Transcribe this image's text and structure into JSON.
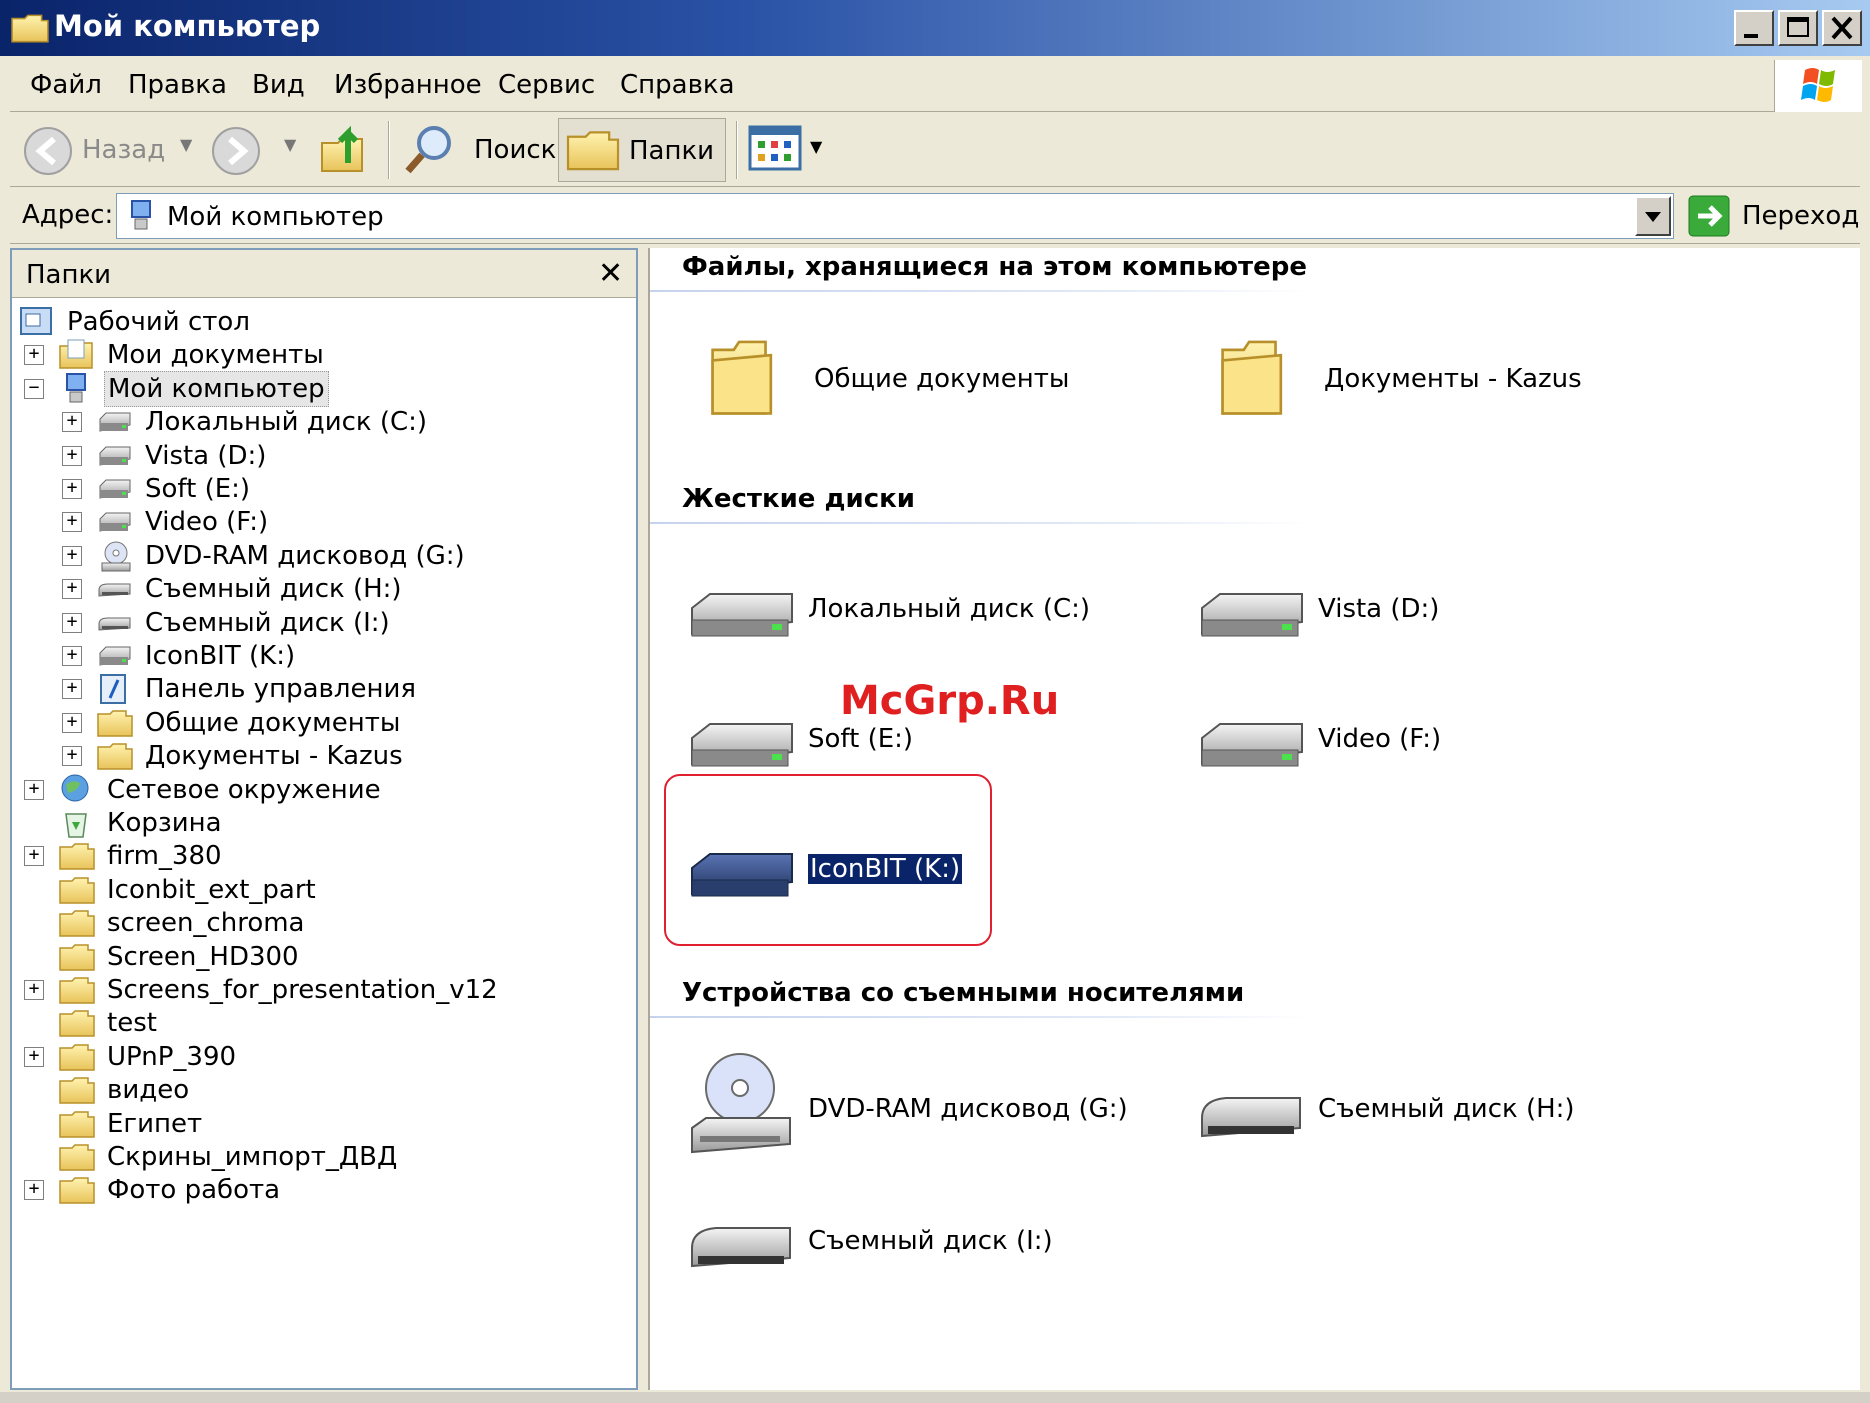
{
  "window": {
    "title": "Мой компьютер"
  },
  "menu": {
    "items": [
      "Файл",
      "Правка",
      "Вид",
      "Избранное",
      "Сервис",
      "Справка"
    ]
  },
  "toolbar": {
    "back_label": "Назад",
    "search_label": "Поиск",
    "folders_label": "Папки"
  },
  "address": {
    "label": "Адрес:",
    "value": "Мой компьютер",
    "go_label": "Переход"
  },
  "folders_pane": {
    "title": "Папки",
    "close_glyph": "✕",
    "tree": [
      {
        "label": "Рабочий стол",
        "icon": "desktop-icon",
        "level": 0,
        "expander": ""
      },
      {
        "label": "Мои документы",
        "icon": "my-documents-icon",
        "level": 1,
        "expander": "+"
      },
      {
        "label": "Мой компьютер",
        "icon": "my-computer-icon",
        "level": 1,
        "expander": "−",
        "selected": true
      },
      {
        "label": "Локальный диск (C:)",
        "icon": "hard-drive-icon",
        "level": 2,
        "expander": "+"
      },
      {
        "label": "Vista (D:)",
        "icon": "hard-drive-icon",
        "level": 2,
        "expander": "+"
      },
      {
        "label": "Soft (E:)",
        "icon": "hard-drive-icon",
        "level": 2,
        "expander": "+"
      },
      {
        "label": "Video (F:)",
        "icon": "hard-drive-icon",
        "level": 2,
        "expander": "+"
      },
      {
        "label": "DVD-RAM дисковод (G:)",
        "icon": "dvd-drive-icon",
        "level": 2,
        "expander": "+"
      },
      {
        "label": "Съемный диск (H:)",
        "icon": "removable-drive-icon",
        "level": 2,
        "expander": "+"
      },
      {
        "label": "Съемный диск (I:)",
        "icon": "removable-drive-icon",
        "level": 2,
        "expander": "+"
      },
      {
        "label": "IconBIT (K:)",
        "icon": "hard-drive-icon",
        "level": 2,
        "expander": "+"
      },
      {
        "label": "Панель управления",
        "icon": "control-panel-icon",
        "level": 2,
        "expander": "+"
      },
      {
        "label": "Общие документы",
        "icon": "folder-icon",
        "level": 2,
        "expander": "+"
      },
      {
        "label": "Документы - Kazus",
        "icon": "folder-icon",
        "level": 2,
        "expander": "+"
      },
      {
        "label": "Сетевое окружение",
        "icon": "network-icon",
        "level": 1,
        "expander": "+"
      },
      {
        "label": "Корзина",
        "icon": "recycle-bin-icon",
        "level": 1,
        "expander": ""
      },
      {
        "label": "firm_380",
        "icon": "folder-icon",
        "level": 1,
        "expander": "+"
      },
      {
        "label": "Iconbit_ext_part",
        "icon": "folder-icon",
        "level": 1,
        "expander": ""
      },
      {
        "label": "screen_chroma",
        "icon": "folder-icon",
        "level": 1,
        "expander": ""
      },
      {
        "label": "Screen_HD300",
        "icon": "folder-icon",
        "level": 1,
        "expander": ""
      },
      {
        "label": "Screens_for_presentation_v12",
        "icon": "folder-icon",
        "level": 1,
        "expander": "+"
      },
      {
        "label": "test",
        "icon": "folder-icon",
        "level": 1,
        "expander": ""
      },
      {
        "label": "UPnP_390",
        "icon": "folder-icon",
        "level": 1,
        "expander": "+"
      },
      {
        "label": "видео",
        "icon": "folder-icon",
        "level": 1,
        "expander": ""
      },
      {
        "label": "Египет",
        "icon": "folder-icon",
        "level": 1,
        "expander": ""
      },
      {
        "label": "Скрины_импорт_ДВД",
        "icon": "folder-icon",
        "level": 1,
        "expander": ""
      },
      {
        "label": "Фото работа",
        "icon": "folder-icon",
        "level": 1,
        "expander": "+"
      }
    ]
  },
  "content": {
    "groups": [
      {
        "header": "Файлы, хранящиеся на этом компьютере",
        "items": [
          {
            "label": "Общие документы",
            "icon": "folder-large-icon"
          },
          {
            "label": "Документы - Kazus",
            "icon": "folder-large-icon"
          }
        ]
      },
      {
        "header": "Жесткие диски",
        "items": [
          {
            "label": "Локальный диск (C:)",
            "icon": "hard-drive-large-icon"
          },
          {
            "label": "Vista (D:)",
            "icon": "hard-drive-large-icon"
          },
          {
            "label": "Soft (E:)",
            "icon": "hard-drive-large-icon"
          },
          {
            "label": "Video (F:)",
            "icon": "hard-drive-large-icon"
          },
          {
            "label": "IconBIT (K:)",
            "icon": "hard-drive-dark-large-icon",
            "selected": true
          }
        ]
      },
      {
        "header": "Устройства со съемными носителями",
        "items": [
          {
            "label": "DVD-RAM дисковод (G:)",
            "icon": "dvd-drive-large-icon"
          },
          {
            "label": "Съемный диск (H:)",
            "icon": "removable-drive-large-icon"
          },
          {
            "label": "Съемный диск (I:)",
            "icon": "removable-drive-large-icon"
          }
        ]
      }
    ],
    "watermark": "McGrp.Ru"
  },
  "colors": {
    "selection": "#0A246A",
    "highlight_box": "#E02030",
    "watermark": "#E02020"
  }
}
